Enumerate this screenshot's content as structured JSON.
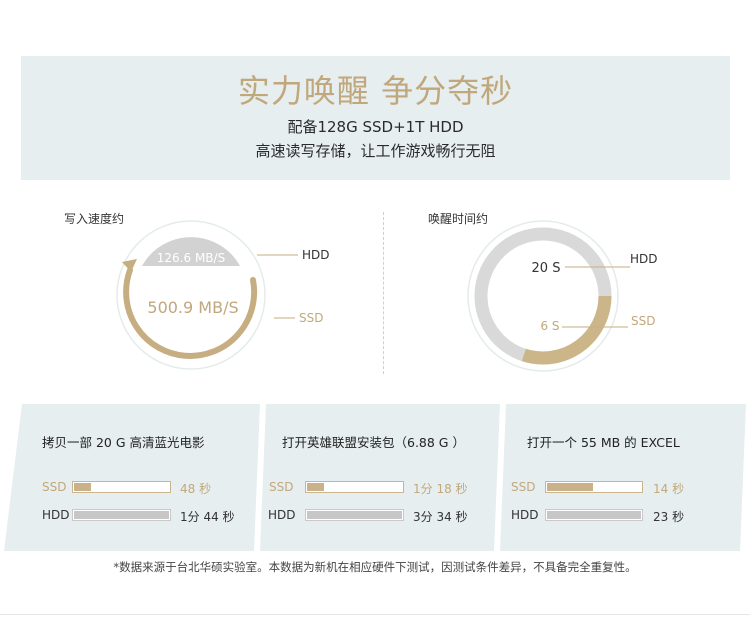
{
  "hero": {
    "title": "实力唤醒 争分夺秒",
    "line1": "配备128G SSD+1T HDD",
    "line2": "高速读写存储，让工作游戏畅行无阻"
  },
  "write_speed": {
    "label": "写入速度约",
    "hdd_value": "126.6 MB/S",
    "ssd_value": "500.9 MB/S",
    "hdd_tag": "HDD",
    "ssd_tag": "SSD"
  },
  "wake_time": {
    "label": "唤醒时间约",
    "hdd_value": "20 S",
    "ssd_value": "6 S",
    "hdd_tag": "HDD",
    "ssd_tag": "SSD",
    "ssd_fraction": 0.3
  },
  "panels": [
    {
      "title": "拷贝一部 20 G 高清蓝光电影",
      "ssd_label": "SSD",
      "ssd_time": "48 秒",
      "ssd_fraction": 0.2,
      "hdd_label": "HDD",
      "hdd_time": "1分 44 秒",
      "hdd_fraction": 1.0
    },
    {
      "title": "打开英雄联盟安装包（6.88 G ）",
      "ssd_label": "SSD",
      "ssd_time": "1分 18 秒",
      "ssd_fraction": 0.2,
      "hdd_label": "HDD",
      "hdd_time": "3分 34 秒",
      "hdd_fraction": 1.0
    },
    {
      "title": "打开一个 55 MB 的 EXCEL",
      "ssd_label": "SSD",
      "ssd_time": "14 秒",
      "ssd_fraction": 0.5,
      "hdd_label": "HDD",
      "hdd_time": "23 秒",
      "hdd_fraction": 1.0
    }
  ],
  "footnote": "*数据来源于台北华硕实验室。本数据为新机在相应硬件下测试，因测试条件差异，不具备完全重复性。",
  "colors": {
    "gold": "#c1a77c",
    "hero_bg": "#e6eeef",
    "gray": "#d9d9d9"
  }
}
